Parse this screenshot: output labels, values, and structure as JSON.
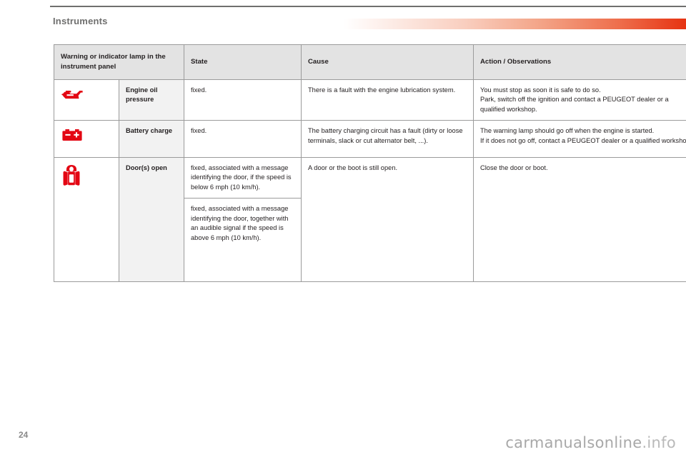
{
  "header": {
    "section_title": "Instruments",
    "accent_color": "#e63312",
    "rule_color": "#6f6f6e"
  },
  "table": {
    "columns": [
      {
        "key": "lamp",
        "label": "Warning or indicator lamp in the instrument panel"
      },
      {
        "key": "state",
        "label": "State"
      },
      {
        "key": "cause",
        "label": "Cause"
      },
      {
        "key": "action",
        "label": "Action / Observations"
      }
    ],
    "rows": [
      {
        "icon": "engine-oil-pressure-icon",
        "icon_color": "#e30613",
        "name": "Engine oil pressure",
        "states": [
          "fixed."
        ],
        "cause": "There is a fault with the engine lubrication system.",
        "action": "You must stop as soon it is safe to do so.\nPark, switch off the ignition and contact a PEUGEOT dealer or a qualified workshop."
      },
      {
        "icon": "battery-charge-icon",
        "icon_color": "#e30613",
        "name": "Battery charge",
        "states": [
          "fixed."
        ],
        "cause": "The battery charging circuit has a fault (dirty or loose terminals, slack or cut alternator belt, ...).",
        "action": "The warning lamp should go off when the engine is started.\nIf it does not go off, contact a PEUGEOT dealer or a qualified workshop."
      },
      {
        "icon": "doors-open-icon",
        "icon_color": "#e30613",
        "name": "Door(s) open",
        "states": [
          "fixed, associated with a message identifying the door, if the speed is below 6 mph (10 km/h).",
          "fixed, associated with a message identifying the door, together with an audible signal if the speed is above 6 mph (10 km/h)."
        ],
        "cause": "A door or the boot is still open.",
        "action": "Close the door or boot."
      }
    ]
  },
  "footer": {
    "page_number": "24",
    "watermark_name": "carmanualsonline",
    "watermark_tld": ".info"
  }
}
